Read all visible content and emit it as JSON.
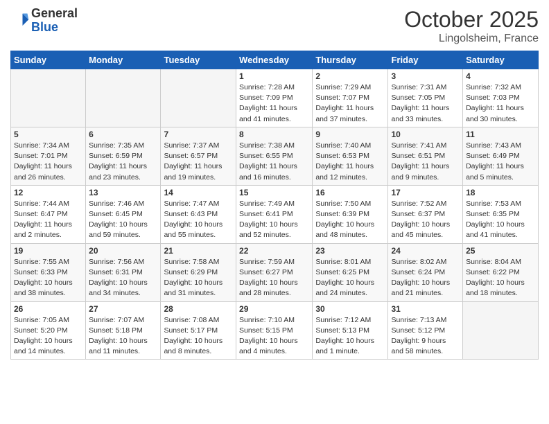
{
  "header": {
    "logo_general": "General",
    "logo_blue": "Blue",
    "month": "October 2025",
    "location": "Lingolsheim, France"
  },
  "weekdays": [
    "Sunday",
    "Monday",
    "Tuesday",
    "Wednesday",
    "Thursday",
    "Friday",
    "Saturday"
  ],
  "weeks": [
    [
      {
        "day": "",
        "info": ""
      },
      {
        "day": "",
        "info": ""
      },
      {
        "day": "",
        "info": ""
      },
      {
        "day": "1",
        "info": "Sunrise: 7:28 AM\nSunset: 7:09 PM\nDaylight: 11 hours\nand 41 minutes."
      },
      {
        "day": "2",
        "info": "Sunrise: 7:29 AM\nSunset: 7:07 PM\nDaylight: 11 hours\nand 37 minutes."
      },
      {
        "day": "3",
        "info": "Sunrise: 7:31 AM\nSunset: 7:05 PM\nDaylight: 11 hours\nand 33 minutes."
      },
      {
        "day": "4",
        "info": "Sunrise: 7:32 AM\nSunset: 7:03 PM\nDaylight: 11 hours\nand 30 minutes."
      }
    ],
    [
      {
        "day": "5",
        "info": "Sunrise: 7:34 AM\nSunset: 7:01 PM\nDaylight: 11 hours\nand 26 minutes."
      },
      {
        "day": "6",
        "info": "Sunrise: 7:35 AM\nSunset: 6:59 PM\nDaylight: 11 hours\nand 23 minutes."
      },
      {
        "day": "7",
        "info": "Sunrise: 7:37 AM\nSunset: 6:57 PM\nDaylight: 11 hours\nand 19 minutes."
      },
      {
        "day": "8",
        "info": "Sunrise: 7:38 AM\nSunset: 6:55 PM\nDaylight: 11 hours\nand 16 minutes."
      },
      {
        "day": "9",
        "info": "Sunrise: 7:40 AM\nSunset: 6:53 PM\nDaylight: 11 hours\nand 12 minutes."
      },
      {
        "day": "10",
        "info": "Sunrise: 7:41 AM\nSunset: 6:51 PM\nDaylight: 11 hours\nand 9 minutes."
      },
      {
        "day": "11",
        "info": "Sunrise: 7:43 AM\nSunset: 6:49 PM\nDaylight: 11 hours\nand 5 minutes."
      }
    ],
    [
      {
        "day": "12",
        "info": "Sunrise: 7:44 AM\nSunset: 6:47 PM\nDaylight: 11 hours\nand 2 minutes."
      },
      {
        "day": "13",
        "info": "Sunrise: 7:46 AM\nSunset: 6:45 PM\nDaylight: 10 hours\nand 59 minutes."
      },
      {
        "day": "14",
        "info": "Sunrise: 7:47 AM\nSunset: 6:43 PM\nDaylight: 10 hours\nand 55 minutes."
      },
      {
        "day": "15",
        "info": "Sunrise: 7:49 AM\nSunset: 6:41 PM\nDaylight: 10 hours\nand 52 minutes."
      },
      {
        "day": "16",
        "info": "Sunrise: 7:50 AM\nSunset: 6:39 PM\nDaylight: 10 hours\nand 48 minutes."
      },
      {
        "day": "17",
        "info": "Sunrise: 7:52 AM\nSunset: 6:37 PM\nDaylight: 10 hours\nand 45 minutes."
      },
      {
        "day": "18",
        "info": "Sunrise: 7:53 AM\nSunset: 6:35 PM\nDaylight: 10 hours\nand 41 minutes."
      }
    ],
    [
      {
        "day": "19",
        "info": "Sunrise: 7:55 AM\nSunset: 6:33 PM\nDaylight: 10 hours\nand 38 minutes."
      },
      {
        "day": "20",
        "info": "Sunrise: 7:56 AM\nSunset: 6:31 PM\nDaylight: 10 hours\nand 34 minutes."
      },
      {
        "day": "21",
        "info": "Sunrise: 7:58 AM\nSunset: 6:29 PM\nDaylight: 10 hours\nand 31 minutes."
      },
      {
        "day": "22",
        "info": "Sunrise: 7:59 AM\nSunset: 6:27 PM\nDaylight: 10 hours\nand 28 minutes."
      },
      {
        "day": "23",
        "info": "Sunrise: 8:01 AM\nSunset: 6:25 PM\nDaylight: 10 hours\nand 24 minutes."
      },
      {
        "day": "24",
        "info": "Sunrise: 8:02 AM\nSunset: 6:24 PM\nDaylight: 10 hours\nand 21 minutes."
      },
      {
        "day": "25",
        "info": "Sunrise: 8:04 AM\nSunset: 6:22 PM\nDaylight: 10 hours\nand 18 minutes."
      }
    ],
    [
      {
        "day": "26",
        "info": "Sunrise: 7:05 AM\nSunset: 5:20 PM\nDaylight: 10 hours\nand 14 minutes."
      },
      {
        "day": "27",
        "info": "Sunrise: 7:07 AM\nSunset: 5:18 PM\nDaylight: 10 hours\nand 11 minutes."
      },
      {
        "day": "28",
        "info": "Sunrise: 7:08 AM\nSunset: 5:17 PM\nDaylight: 10 hours\nand 8 minutes."
      },
      {
        "day": "29",
        "info": "Sunrise: 7:10 AM\nSunset: 5:15 PM\nDaylight: 10 hours\nand 4 minutes."
      },
      {
        "day": "30",
        "info": "Sunrise: 7:12 AM\nSunset: 5:13 PM\nDaylight: 10 hours\nand 1 minute."
      },
      {
        "day": "31",
        "info": "Sunrise: 7:13 AM\nSunset: 5:12 PM\nDaylight: 9 hours\nand 58 minutes."
      },
      {
        "day": "",
        "info": ""
      }
    ]
  ]
}
